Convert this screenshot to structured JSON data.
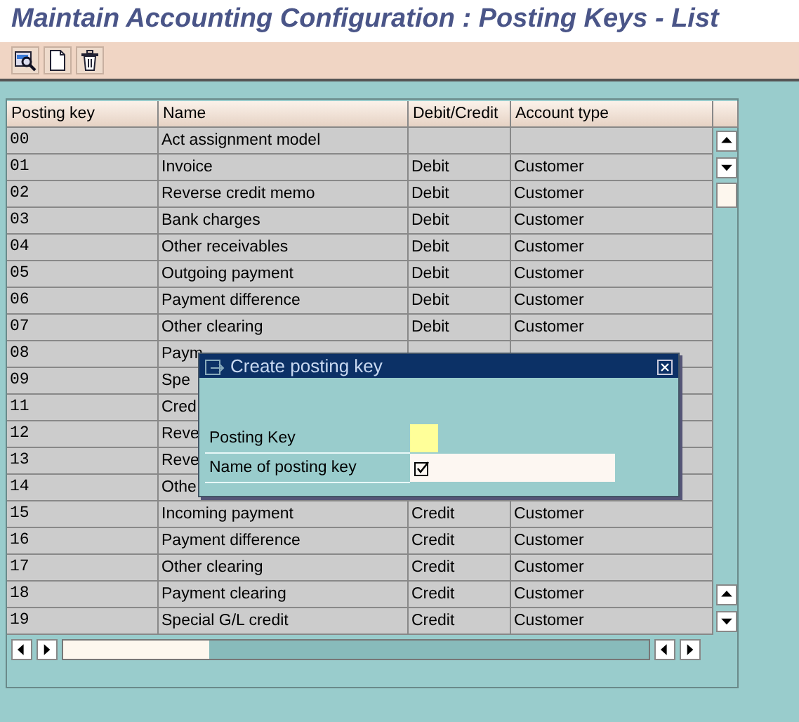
{
  "title": "Maintain Accounting Configuration : Posting Keys - List",
  "toolbar": [
    {
      "kind": "details"
    },
    {
      "kind": "create"
    },
    {
      "kind": "delete"
    }
  ],
  "table": {
    "columns": [
      "Posting key",
      "Name",
      "Debit/Credit",
      "Account type"
    ],
    "rows": [
      {
        "key": "00",
        "name": "Act assignment model"
      },
      {
        "key": "01",
        "name": "Invoice",
        "debit_credit": "Debit",
        "account_type": "Customer"
      },
      {
        "key": "02",
        "name": "Reverse credit memo",
        "debit_credit": "Debit",
        "account_type": "Customer"
      },
      {
        "key": "03",
        "name": "Bank charges",
        "debit_credit": "Debit",
        "account_type": "Customer"
      },
      {
        "key": "04",
        "name": "Other receivables",
        "debit_credit": "Debit",
        "account_type": "Customer"
      },
      {
        "key": "05",
        "name": "Outgoing payment",
        "debit_credit": "Debit",
        "account_type": "Customer"
      },
      {
        "key": "06",
        "name": "Payment difference",
        "debit_credit": "Debit",
        "account_type": "Customer"
      },
      {
        "key": "07",
        "name": "Other clearing",
        "debit_credit": "Debit",
        "account_type": "Customer"
      },
      {
        "key": "08",
        "name": "Paym"
      },
      {
        "key": "09",
        "name": "Spe"
      },
      {
        "key": "11",
        "name": "Cred"
      },
      {
        "key": "12",
        "name": "Reve"
      },
      {
        "key": "13",
        "name": "Reve"
      },
      {
        "key": "14",
        "name": "Othe"
      },
      {
        "key": "15",
        "name": "Incoming payment",
        "debit_credit": "Credit",
        "account_type": "Customer"
      },
      {
        "key": "16",
        "name": "Payment difference",
        "debit_credit": "Credit",
        "account_type": "Customer"
      },
      {
        "key": "17",
        "name": "Other clearing",
        "debit_credit": "Credit",
        "account_type": "Customer"
      },
      {
        "key": "18",
        "name": "Payment clearing",
        "debit_credit": "Credit",
        "account_type": "Customer"
      },
      {
        "key": "19",
        "name": "Special G/L credit",
        "debit_credit": "Credit",
        "account_type": "Customer"
      }
    ]
  },
  "dialog": {
    "title": "Create posting key",
    "fields": [
      {
        "label": "Posting Key",
        "required": true,
        "check": false
      },
      {
        "label": "Name of posting key",
        "required": false,
        "check": true
      }
    ]
  }
}
